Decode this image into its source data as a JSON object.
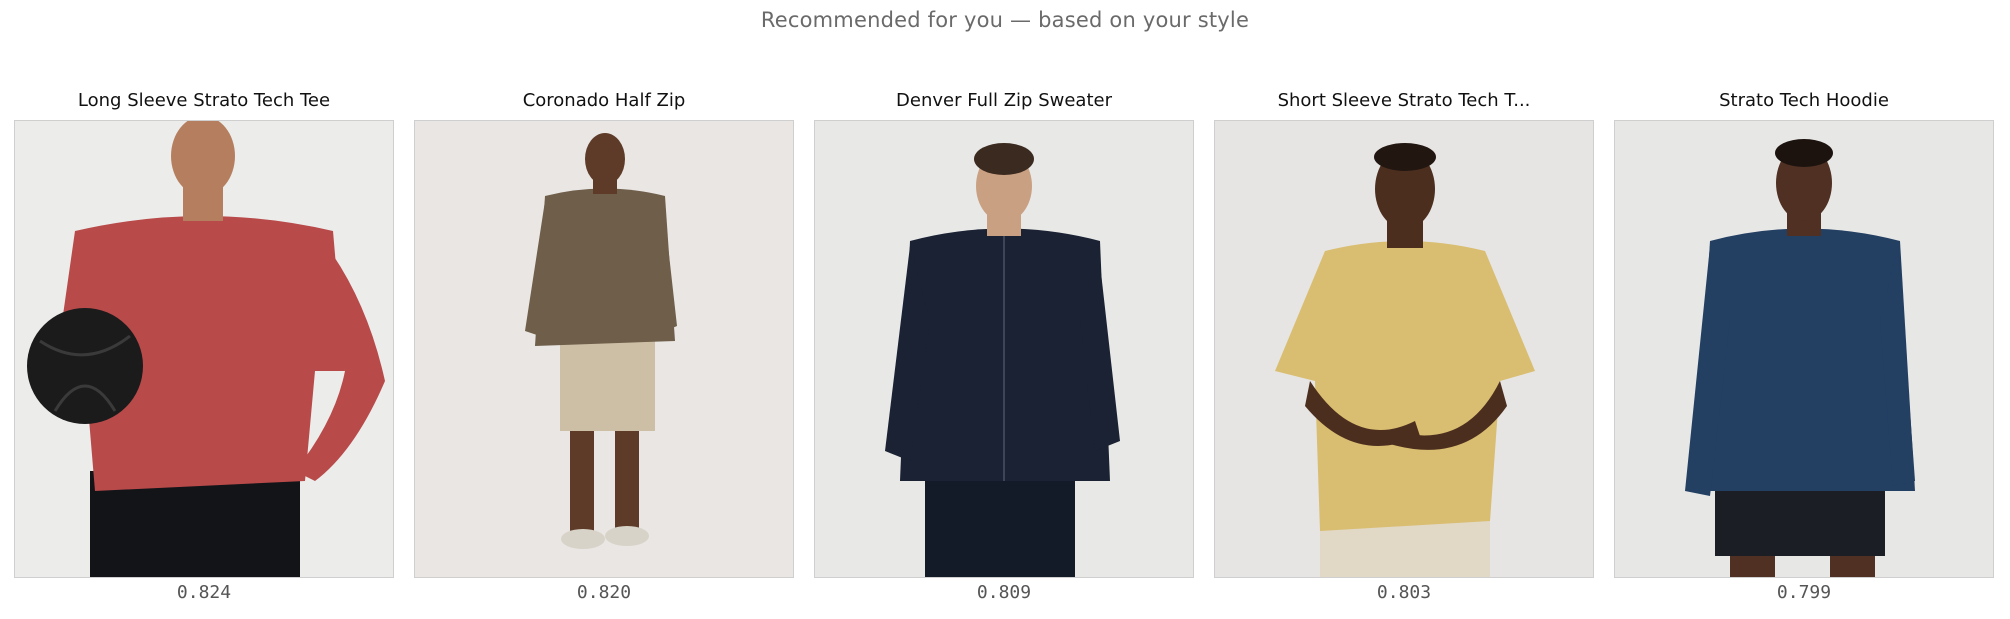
{
  "header": {
    "text": "Recommended for you — based on your style"
  },
  "products": [
    {
      "title": "Long Sleeve Strato Tech Tee",
      "score": "0.824",
      "bg": "#ececeb",
      "top_color": "#b84a4a",
      "bottom_color": "#121418",
      "skin": "#b57f5f",
      "prop": "ball"
    },
    {
      "title": "Coronado Half Zip",
      "score": "0.820",
      "bg": "#e9e6e3",
      "top_color": "#6e5e4a",
      "bottom_color": "#cdbfa6",
      "skin": "#5e3b28",
      "prop": "none"
    },
    {
      "title": "Denver Full Zip Sweater",
      "score": "0.809",
      "bg": "#e8e8e7",
      "top_color": "#1a2233",
      "bottom_color": "#141b28",
      "skin": "#caa083",
      "prop": "none"
    },
    {
      "title": "Short Sleeve Strato Tech T...",
      "score": "0.803",
      "bg": "#e6e5e3",
      "top_color": "#d9bd70",
      "bottom_color": "#e1d8c6",
      "skin": "#4c2e1f",
      "prop": "none"
    },
    {
      "title": "Strato Tech Hoodie",
      "score": "0.799",
      "bg": "#e7e7e6",
      "top_color": "#233f62",
      "bottom_color": "#1b1e25",
      "skin": "#4f3022",
      "prop": "none"
    }
  ]
}
